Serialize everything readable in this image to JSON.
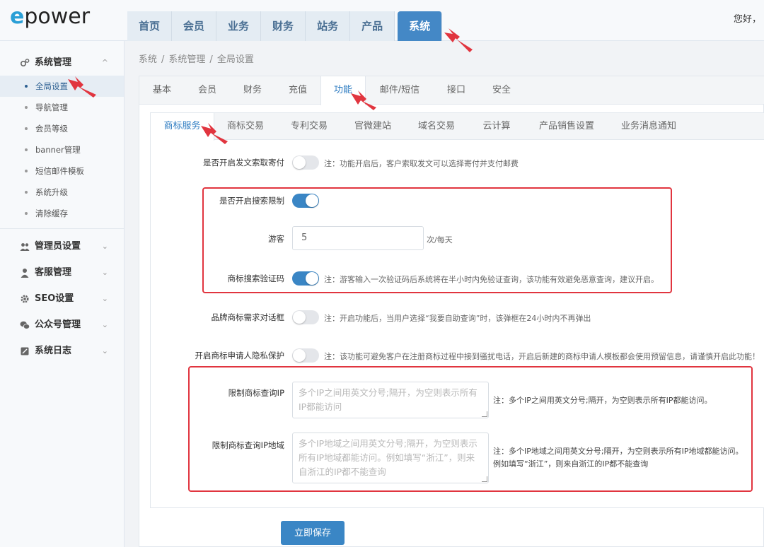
{
  "brand": {
    "logo_e": "e",
    "logo_rest": "power"
  },
  "header": {
    "nav": [
      "首页",
      "会员",
      "业务",
      "财务",
      "站务",
      "产品",
      "系统"
    ],
    "active_nav": "系统",
    "greeting": "您好，"
  },
  "sidebar": {
    "group_system": {
      "label": "系统管理",
      "chevron": "^",
      "icon": "gears-icon"
    },
    "items": [
      "全局设置",
      "导航管理",
      "会员等级",
      "banner管理",
      "短信邮件模板",
      "系统升级",
      "清除缓存"
    ],
    "active_item": "全局设置",
    "groups": [
      {
        "label": "管理员设置",
        "icon": "users-icon"
      },
      {
        "label": "客服管理",
        "icon": "user-icon"
      },
      {
        "label": "SEO设置",
        "icon": "gear-icon"
      },
      {
        "label": "公众号管理",
        "icon": "wechat-icon"
      },
      {
        "label": "系统日志",
        "icon": "log-icon"
      }
    ],
    "chevron_down": "⌄"
  },
  "breadcrumb": [
    "系统",
    "系统管理",
    "全局设置"
  ],
  "tabs": [
    "基本",
    "会员",
    "财务",
    "充值",
    "功能",
    "邮件/短信",
    "接口",
    "安全"
  ],
  "active_tab": "功能",
  "subtabs": [
    "商标服务",
    "商标交易",
    "专利交易",
    "官微建站",
    "域名交易",
    "云计算",
    "产品销售设置",
    "业务消息通知"
  ],
  "active_subtab": "商标服务",
  "form": {
    "mail_label": "是否开启发文索取寄付",
    "mail_on": false,
    "mail_note": "注：功能开启后，客户索取发文可以选择寄付并支付邮费",
    "search_limit_label": "是否开启搜索限制",
    "search_limit_on": true,
    "guest_label": "游客",
    "guest_value": "5",
    "guest_unit": "次/每天",
    "captcha_label": "商标搜索验证码",
    "captcha_on": true,
    "captcha_note": "注：游客输入一次验证码后系统将在半小时内免验证查询，该功能有效避免恶意查询，建议开启。",
    "brand_dialog_label": "品牌商标需求对话框",
    "brand_dialog_on": false,
    "brand_dialog_note": "注：开启功能后，当用户选择“我要自助查询”时，该弹框在24小时内不再弹出",
    "privacy_label": "开启商标申请人隐私保护",
    "privacy_on": false,
    "privacy_note": "注：该功能可避免客户在注册商标过程中接到骚扰电话，开启后新建的商标申请人模板都会使用预留信息，请谨慎开启此功能！",
    "ip_label": "限制商标查询IP",
    "ip_placeholder": "多个IP之间用英文分号;隔开，为空则表示所有IP都能访问",
    "ip_note": "注：多个IP之间用英文分号;隔开，为空则表示所有IP都能访问。",
    "region_label": "限制商标查询IP地域",
    "region_placeholder": "多个IP地域之间用英文分号;隔开，为空则表示所有IP地域都能访问。例如填写“浙江”，则来自浙江的IP都不能查询",
    "region_note_1": "注：多个IP地域之间用英文分号;隔开，为空则表示所有IP地域都能访问。",
    "region_note_2": "例如填写“浙江”，则来自浙江的IP都不能查询"
  },
  "save_label": "立即保存",
  "colors": {
    "accent": "#3a86c5",
    "highlight": "#e1353f"
  }
}
